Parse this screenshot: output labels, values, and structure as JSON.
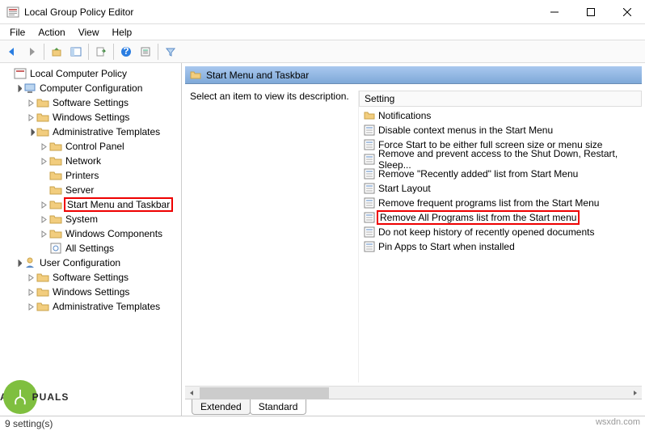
{
  "window": {
    "title": "Local Group Policy Editor"
  },
  "menu": {
    "file": "File",
    "action": "Action",
    "view": "View",
    "help": "Help"
  },
  "tree": {
    "root": "Local Computer Policy",
    "compConf": "Computer Configuration",
    "swSettings": "Software Settings",
    "winSettings": "Windows Settings",
    "adminTpl": "Administrative Templates",
    "ctrlPanel": "Control Panel",
    "network": "Network",
    "printers": "Printers",
    "server": "Server",
    "startMenu": "Start Menu and Taskbar",
    "system": "System",
    "winComp": "Windows Components",
    "allSettings": "All Settings",
    "userConf": "User Configuration",
    "u_sw": "Software Settings",
    "u_win": "Windows Settings",
    "u_admin": "Administrative Templates"
  },
  "detail": {
    "header": "Start Menu and Taskbar",
    "desc": "Select an item to view its description.",
    "colSetting": "Setting",
    "items": {
      "notifications": "Notifications",
      "disableCtx": "Disable context menus in the Start Menu",
      "forceStart": "Force Start to be either full screen size or menu size",
      "removeShut": "Remove and prevent access to the Shut Down, Restart, Sleep...",
      "removeRecent": "Remove \"Recently added\" list from Start Menu",
      "startLayout": "Start Layout",
      "removeFreq": "Remove frequent programs list from the Start Menu",
      "removeAll": "Remove All Programs list from the Start menu",
      "noHistory": "Do not keep history of recently opened documents",
      "pinApps": "Pin Apps to Start when installed"
    }
  },
  "tabs": {
    "extended": "Extended",
    "standard": "Standard"
  },
  "status": "9 setting(s)",
  "brand": {
    "a": "A",
    "p": "PUALS",
    "wm": "wsxdn.com"
  }
}
